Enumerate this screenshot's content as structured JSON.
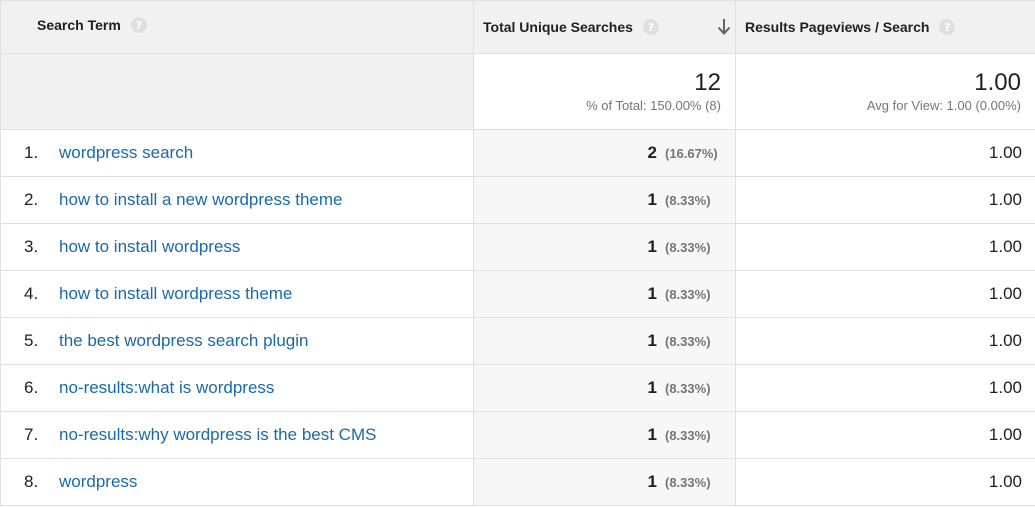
{
  "header": {
    "col1": "Search Term",
    "col2": "Total Unique Searches",
    "col3": "Results Pageviews / Search",
    "help_glyph": "?"
  },
  "totals": {
    "unique": "12",
    "unique_sub": "% of Total: 150.00% (8)",
    "pageviews": "1.00",
    "pageviews_sub": "Avg for View: 1.00 (0.00%)"
  },
  "rows": [
    {
      "index": "1.",
      "term": "wordpress search",
      "unique": "2",
      "pct": "(16.67%)",
      "pageviews": "1.00"
    },
    {
      "index": "2.",
      "term": "how to install a new wordpress theme",
      "unique": "1",
      "pct": "(8.33%)",
      "pageviews": "1.00"
    },
    {
      "index": "3.",
      "term": "how to install wordpress",
      "unique": "1",
      "pct": "(8.33%)",
      "pageviews": "1.00"
    },
    {
      "index": "4.",
      "term": "how to install wordpress theme",
      "unique": "1",
      "pct": "(8.33%)",
      "pageviews": "1.00"
    },
    {
      "index": "5.",
      "term": "the best wordpress search plugin",
      "unique": "1",
      "pct": "(8.33%)",
      "pageviews": "1.00"
    },
    {
      "index": "6.",
      "term": "no-results:what is wordpress",
      "unique": "1",
      "pct": "(8.33%)",
      "pageviews": "1.00"
    },
    {
      "index": "7.",
      "term": "no-results:why wordpress is the best CMS",
      "unique": "1",
      "pct": "(8.33%)",
      "pageviews": "1.00"
    },
    {
      "index": "8.",
      "term": "wordpress",
      "unique": "1",
      "pct": "(8.33%)",
      "pageviews": "1.00"
    }
  ],
  "colors": {
    "link": "#1a6aa8",
    "header_bg": "#f1f1f1",
    "help_bg": "#dfdfdf",
    "sorted_col_bg": "#f7f7f7"
  },
  "icons": {
    "help": "help-circle-icon",
    "sort": "arrow-down-icon"
  }
}
